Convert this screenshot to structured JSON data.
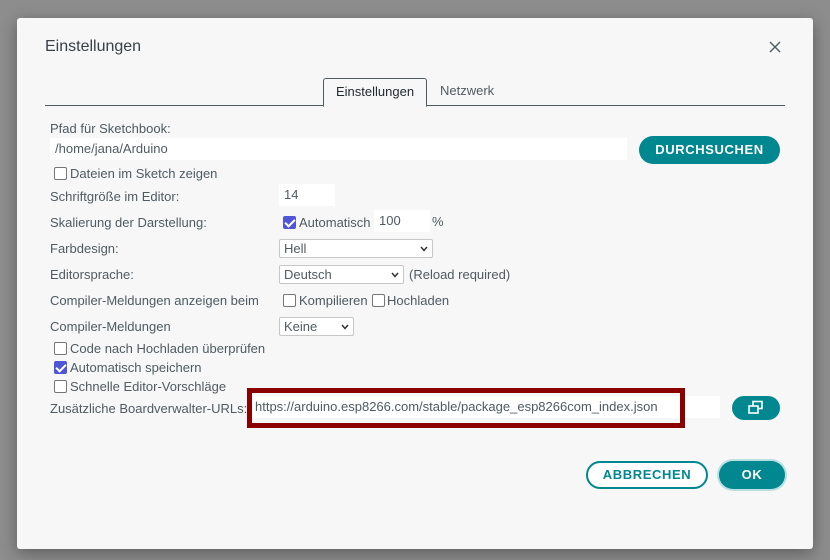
{
  "dialog": {
    "title": "Einstellungen",
    "tabs": [
      {
        "label": "Einstellungen",
        "active": true
      },
      {
        "label": "Netzwerk",
        "active": false
      }
    ]
  },
  "sketchbook": {
    "label": "Pfad für Sketchbook:",
    "path": "/home/jana/Arduino",
    "browse_label": "DURCHSUCHEN",
    "show_files_label": "Dateien im Sketch zeigen",
    "show_files_checked": false
  },
  "font_size": {
    "label": "Schriftgröße im Editor:",
    "value": "14"
  },
  "scaling": {
    "label": "Skalierung der Darstellung:",
    "auto_label": "Automatisch",
    "auto_checked": true,
    "value": "100",
    "unit": "%"
  },
  "theme": {
    "label": "Farbdesign:",
    "value": "Hell"
  },
  "language": {
    "label": "Editorsprache:",
    "value": "Deutsch",
    "note": "(Reload required)"
  },
  "compiler_output": {
    "label": "Compiler-Meldungen anzeigen beim",
    "compile_label": "Kompilieren",
    "compile_checked": false,
    "upload_label": "Hochladen",
    "upload_checked": false
  },
  "compiler_warnings": {
    "label": "Compiler-Meldungen",
    "value": "Keine"
  },
  "options": [
    {
      "label": "Code nach Hochladen überprüfen",
      "checked": false
    },
    {
      "label": "Automatisch speichern",
      "checked": true
    },
    {
      "label": "Schnelle Editor-Vorschläge",
      "checked": false
    }
  ],
  "board_urls": {
    "label": "Zusätzliche Boardverwalter-URLs:",
    "value": "https://arduino.esp8266.com/stable/package_esp8266com_index.json"
  },
  "footer": {
    "cancel_label": "ABBRECHEN",
    "ok_label": "OK"
  },
  "colors": {
    "accent": "#00878f",
    "highlight": "#8b0000",
    "checkbox": "#4f55d6"
  }
}
